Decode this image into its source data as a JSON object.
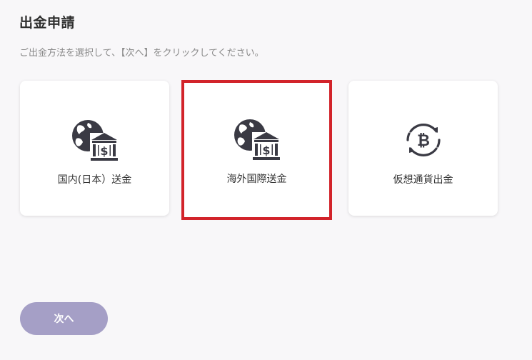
{
  "page": {
    "title": "出金申請",
    "instruction": "ご出金方法を選択して、【次へ】をクリックしてください。"
  },
  "options": [
    {
      "label": "国内(日本）送金",
      "icon": "globe-bank-icon",
      "selected": false
    },
    {
      "label": "海外国際送金",
      "icon": "globe-bank-icon",
      "selected": true
    },
    {
      "label": "仮想通貨出金",
      "icon": "bitcoin-cycle-icon",
      "selected": false
    }
  ],
  "next_button": {
    "label": "次へ"
  },
  "colors": {
    "background": "#f8f7f9",
    "icon": "#3a3a44",
    "selected_border": "#d2232a",
    "button_bg": "#a59fc6"
  }
}
